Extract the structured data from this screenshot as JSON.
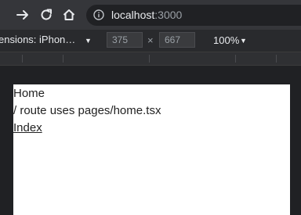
{
  "browser": {
    "url_host": "localhost",
    "url_port": ":3000"
  },
  "device_toolbar": {
    "device_label": "ensions: iPhon…",
    "width_value": "375",
    "height_value": "667",
    "times_symbol": "×",
    "zoom_label": "100%"
  },
  "page": {
    "heading": "Home",
    "route_text": "/ route uses pages/home.tsx",
    "link_label": "Index"
  }
}
